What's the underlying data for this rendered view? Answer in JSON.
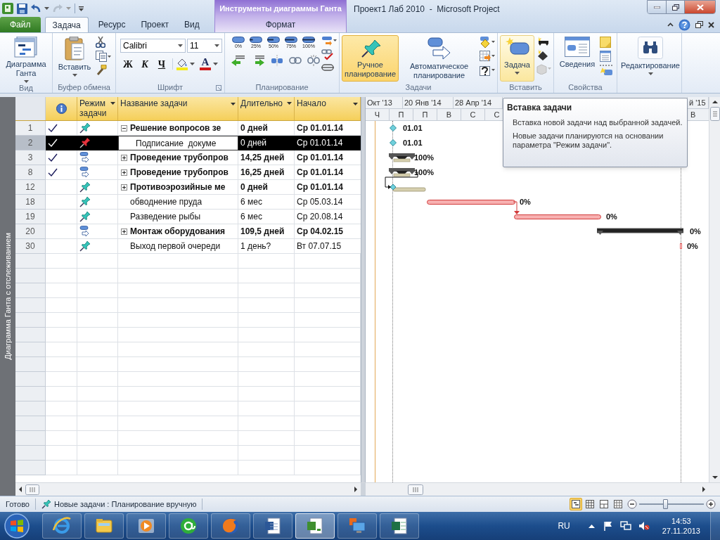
{
  "title_bar": {
    "context_group": "Инструменты диаграммы Ганта",
    "title": "Проект1 Лаб 2010  -  Microsoft Project"
  },
  "tabs": [
    {
      "label": "Файл",
      "kind": "file",
      "selected": false
    },
    {
      "label": "Задача",
      "kind": "main",
      "selected": true
    },
    {
      "label": "Ресурс",
      "kind": "main",
      "selected": false
    },
    {
      "label": "Проект",
      "kind": "main",
      "selected": false
    },
    {
      "label": "Вид",
      "kind": "main",
      "selected": false
    },
    {
      "label": "Формат",
      "kind": "context",
      "selected": false
    }
  ],
  "ribbon": {
    "groups": [
      {
        "kind": "view",
        "label": "Вид",
        "button": "Диаграмма Ганта"
      },
      {
        "kind": "clipboard",
        "label": "Буфер обмена",
        "button": "Вставить"
      },
      {
        "kind": "font",
        "label": "Шрифт",
        "fields": [
          "Calibri",
          "11"
        ],
        "styles": [
          "Ж",
          "К",
          "Ч"
        ],
        "color_glyph": "A"
      },
      {
        "kind": "schedule",
        "label": "Планирование",
        "percents": [
          "0%",
          "25%",
          "50%",
          "75%",
          "100%"
        ]
      },
      {
        "kind": "tasks",
        "label": "Задачи",
        "buttons": [
          {
            "label": "Ручное планирование",
            "selected": true
          },
          {
            "label": "Автоматическое планирование",
            "selected": false
          }
        ]
      },
      {
        "kind": "insert",
        "label": "Вставить",
        "button": "Задача"
      },
      {
        "kind": "properties",
        "label": "Свойства",
        "button": "Сведения"
      },
      {
        "kind": "editing",
        "button": "Редактирование"
      }
    ]
  },
  "view_label": "Диаграмма Ганта с отслеживанием",
  "table": {
    "columns": [
      {
        "kind": "info"
      },
      {
        "kind": "mode",
        "label": "Режим задачи"
      },
      {
        "kind": "name",
        "label": "Название задачи"
      },
      {
        "kind": "duration",
        "label": "Длительно"
      },
      {
        "kind": "start",
        "label": "Начало"
      }
    ],
    "rows": [
      {
        "id": "1",
        "done": true,
        "kind": "manual",
        "summary": true,
        "expanded": true,
        "name": "Решение вопросов зе",
        "duration": "0 дней",
        "start": "Ср 01.01.14",
        "selected": false,
        "children": [
          {
            "id": "2",
            "done": true,
            "kind": "manual_warning",
            "summary": false,
            "name": "Подписание  докуме",
            "duration": "0 дней",
            "start": "Ср 01.01.14",
            "selected": true
          }
        ]
      },
      {
        "id": "3",
        "done": true,
        "kind": "auto",
        "summary": true,
        "expanded": false,
        "name": "Проведение трубопров",
        "duration": "14,25 дней",
        "start": "Ср 01.01.14",
        "selected": false
      },
      {
        "id": "8",
        "done": true,
        "kind": "auto",
        "summary": true,
        "expanded": false,
        "name": "Проведение трубопров",
        "duration": "16,25 дней",
        "start": "Ср 01.01.14",
        "selected": false
      },
      {
        "id": "12",
        "done": false,
        "kind": "manual",
        "summary": true,
        "expanded": false,
        "name": "Противоэрозийные ме",
        "duration": "0 дней",
        "start": "Ср 01.01.14",
        "selected": false
      },
      {
        "id": "18",
        "done": false,
        "kind": "manual",
        "summary": false,
        "name": "обводнение пруда",
        "duration": "6 мес",
        "start": "Ср 05.03.14",
        "selected": false
      },
      {
        "id": "19",
        "done": false,
        "kind": "manual",
        "summary": false,
        "name": "Разведение рыбы",
        "duration": "6 мес",
        "start": "Ср 20.08.14",
        "selected": false
      },
      {
        "id": "20",
        "done": false,
        "kind": "auto",
        "summary": true,
        "expanded": false,
        "name": "Монтаж оборудования",
        "duration": "109,5 дней",
        "start": "Ср 04.02.15",
        "selected": false
      },
      {
        "id": "30",
        "done": false,
        "kind": "manual",
        "summary": false,
        "name": "Выход первой очереди",
        "duration": "1 день?",
        "start": "Вт 07.07.15",
        "selected": false
      }
    ]
  },
  "gantt": {
    "timescale_top": [
      "Окт '13",
      "20 Янв '14",
      "28 Апр '14",
      "й '15"
    ],
    "timescale_bottom": [
      "Ч",
      "П",
      "П",
      "В",
      "С",
      "С",
      "В"
    ],
    "bars": [
      {
        "kind": "milestone",
        "label": "01.01"
      },
      {
        "kind": "milestone",
        "label": "01.01"
      },
      {
        "kind": "summary_done",
        "label": "100%"
      },
      {
        "kind": "summary_done",
        "label": "100%"
      },
      {
        "kind": "manual_milestone"
      },
      {
        "kind": "manual",
        "label": "0%"
      },
      {
        "kind": "manual",
        "label": "0%"
      },
      {
        "kind": "summary",
        "label": "0%"
      },
      {
        "kind": "manual_point",
        "label": "0%"
      }
    ]
  },
  "tooltip": {
    "title": "Вставка задачи",
    "paragraphs": [
      "Вставка новой задачи над выбранной задачей.",
      "Новые задачи планируются на основании параметра \"Режим задачи\"."
    ]
  },
  "status_bar": {
    "ready": "Готово",
    "new_tasks": "Новые задачи : Планирование вручную",
    "views": [
      {
        "selected": true
      },
      {
        "selected": false
      },
      {
        "selected": false
      },
      {
        "selected": false
      }
    ],
    "zoom": {
      "level": 0.4
    }
  },
  "taskbar": {
    "apps": [
      {
        "kind": "ie",
        "selected": false
      },
      {
        "kind": "explorer",
        "selected": false
      },
      {
        "kind": "media",
        "selected": false
      },
      {
        "kind": "mail",
        "selected": false
      },
      {
        "kind": "firefox",
        "selected": false
      },
      {
        "kind": "word",
        "selected": false
      },
      {
        "kind": "project",
        "selected": true
      },
      {
        "kind": "remote",
        "selected": false
      },
      {
        "kind": "excel",
        "selected": false
      }
    ],
    "language": "RU",
    "time": "14:53",
    "date": "27.11.2013"
  }
}
